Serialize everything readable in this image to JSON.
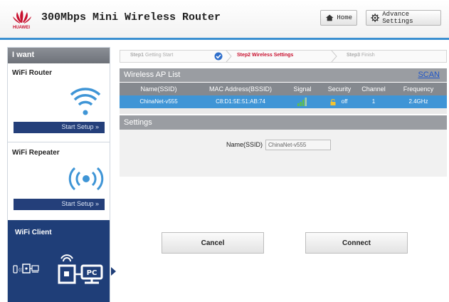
{
  "header": {
    "brand": "HUAWEI",
    "title": "300Mbps Mini Wireless Router",
    "home_label": "Home",
    "advance_label": "Advance Settings"
  },
  "sidebar": {
    "heading": "I want",
    "sections": [
      {
        "title": "WiFi Router",
        "button": "Start Setup »"
      },
      {
        "title": "WiFi Repeater",
        "button": "Start Setup »"
      },
      {
        "title": "WiFi Client"
      }
    ],
    "client_pc_label": "PC"
  },
  "steps": [
    {
      "num": "Step1",
      "label": "Getting Start",
      "state": "done"
    },
    {
      "num": "Step2",
      "label": "Wireless Settings",
      "state": "active"
    },
    {
      "num": "Step3",
      "label": "Finish",
      "state": "pending"
    }
  ],
  "ap_list": {
    "title": "Wireless AP List",
    "scan_label": "SCAN",
    "columns": [
      "Name(SSID)",
      "MAC Address(BSSID)",
      "Signal",
      "Security",
      "Channel",
      "Frequency"
    ],
    "rows": [
      {
        "ssid": "ChinaNet-v555",
        "mac": "C8:D1:5E:51:AB:74",
        "signal_level": 3,
        "security": "off",
        "channel": "1",
        "frequency": "2.4GHz"
      }
    ]
  },
  "settings": {
    "title": "Settings",
    "ssid_label": "Name(SSID)",
    "ssid_value": "ChinaNet-v555"
  },
  "actions": {
    "cancel": "Cancel",
    "connect": "Connect"
  },
  "colors": {
    "accent_blue": "#3a8fd0",
    "sidebar_navy": "#1f3e78",
    "brand_red": "#c8102e",
    "row_selected": "#3f95d6"
  }
}
